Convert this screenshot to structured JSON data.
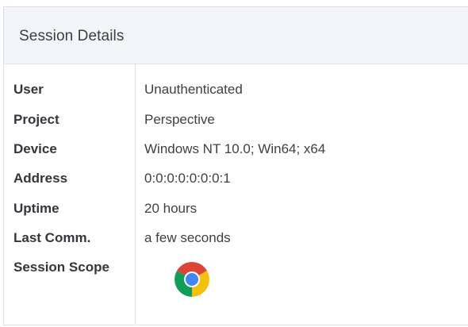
{
  "panel": {
    "title": "Session Details"
  },
  "rows": [
    {
      "label": "User",
      "value": "Unauthenticated"
    },
    {
      "label": "Project",
      "value": "Perspective"
    },
    {
      "label": "Device",
      "value": "Windows NT 10.0; Win64; x64"
    },
    {
      "label": "Address",
      "value": "0:0:0:0:0:0:0:1"
    },
    {
      "label": "Uptime",
      "value": "20 hours"
    },
    {
      "label": "Last Comm.",
      "value": "a few seconds"
    },
    {
      "label": "Session Scope",
      "icon": "chrome-icon"
    }
  ],
  "colors": {
    "header_bg": "#f3f5f8",
    "border": "#dcdfe3",
    "chrome_red": "#db4437",
    "chrome_green": "#0f9d58",
    "chrome_yellow": "#f4c20d",
    "chrome_blue": "#4285f4"
  }
}
